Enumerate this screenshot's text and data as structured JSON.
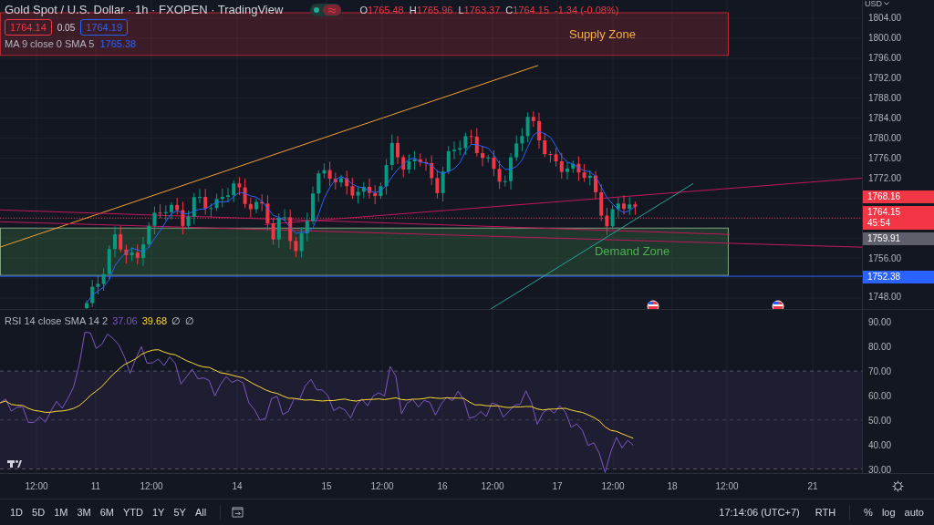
{
  "legend": {
    "title": "Gold Spot / U.S. Dollar · 1h · FXOPEN · TradingView",
    "ohlc": [
      {
        "label": "O",
        "value": "1765.48"
      },
      {
        "label": "H",
        "value": "1765.96"
      },
      {
        "label": "L",
        "value": "1763.37"
      },
      {
        "label": "C",
        "value": "1764.15"
      }
    ],
    "change": "-1.34 (-0.08%)",
    "sell_price": "1764.14",
    "spread": "0.05",
    "buy_price": "1764.19"
  },
  "ma_legend": {
    "label": "MA 9 close 0 SMA 5",
    "values": [
      {
        "text": "1765.38",
        "color": "#2962ff"
      }
    ]
  },
  "zones": [
    {
      "kind": "supply",
      "label": "Supply Zone"
    },
    {
      "kind": "demand",
      "label": "Demand Zone"
    }
  ],
  "price_axis": {
    "currency": "USD",
    "items": [
      {
        "kind": "tick",
        "label": "1804.00"
      },
      {
        "kind": "tick",
        "label": "1800.00"
      },
      {
        "kind": "tick",
        "label": "1796.00"
      },
      {
        "kind": "tick",
        "label": "1792.00"
      },
      {
        "kind": "tick",
        "label": "1788.00"
      },
      {
        "kind": "tick",
        "label": "1784.00"
      },
      {
        "kind": "tick",
        "label": "1780.00"
      },
      {
        "kind": "tick",
        "label": "1776.00"
      },
      {
        "kind": "tick",
        "label": "1772.00"
      },
      {
        "kind": "badge",
        "label": "1768.16",
        "color": "#f23645"
      },
      {
        "kind": "badge",
        "label": "1764.15",
        "sub": "45:54",
        "color": "#f23645"
      },
      {
        "kind": "badge",
        "label": "1759.91",
        "color": "#5d606b"
      },
      {
        "kind": "tick",
        "label": "1756.00"
      },
      {
        "kind": "badge",
        "label": "1752.38",
        "color": "#2962ff"
      },
      {
        "kind": "tick",
        "label": "1748.00"
      }
    ]
  },
  "rsi_legend": {
    "label": "RSI 14 close SMA 14 2",
    "values": [
      {
        "text": "37.06",
        "color": "#7e57c2"
      },
      {
        "text": "39.68",
        "color": "#fdd835"
      },
      {
        "text": "∅"
      },
      {
        "text": "∅"
      }
    ]
  },
  "rsi_axis": [
    "90.00",
    "80.00",
    "70.00",
    "60.00",
    "50.00",
    "40.00",
    "30.00"
  ],
  "time_axis": [
    "12:00",
    "11",
    "12:00",
    "14",
    "15",
    "12:00",
    "16",
    "12:00",
    "17",
    "12:00",
    "18",
    "12:00",
    "21"
  ],
  "ranges": [
    "1D",
    "5D",
    "1M",
    "3M",
    "6M",
    "YTD",
    "1Y",
    "5Y",
    "All"
  ],
  "status": {
    "time": "17:14:06 (UTC+7)",
    "session": "RTH",
    "scale_options": [
      "%",
      "log",
      "auto"
    ]
  }
}
